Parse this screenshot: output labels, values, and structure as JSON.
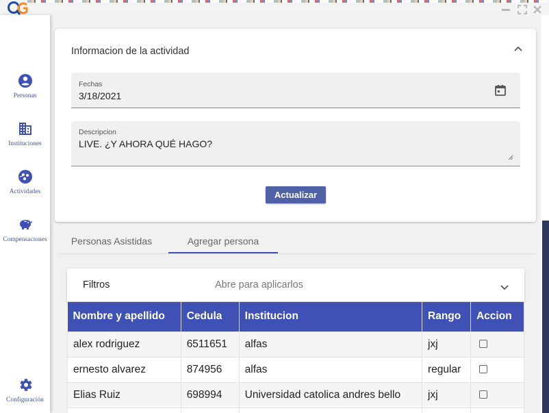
{
  "sidebar": {
    "items": [
      {
        "label": "Personas",
        "icon": "person-circle-icon"
      },
      {
        "label": "Instituciones",
        "icon": "building-icon"
      },
      {
        "label": "Actividades",
        "icon": "activities-icon"
      },
      {
        "label": "Compensaciones",
        "icon": "piggy-bank-icon"
      }
    ],
    "settings_label": "Configuración"
  },
  "card": {
    "title": "Informacion de la actividad",
    "date_label": "Fechas",
    "date_value": "3/18/2021",
    "description_label": "Descripcion",
    "description_value": "LIVE. ¿Y AHORA QUÉ HAGO?",
    "update_button": "Actualizar"
  },
  "tabs": [
    {
      "label": "Personas Asistidas",
      "active": false
    },
    {
      "label": "Agregar persona",
      "active": true
    }
  ],
  "filter": {
    "title": "Filtros",
    "hint": "Abre para aplicarlos"
  },
  "table": {
    "columns": [
      "Nombre y apellido",
      "Cedula",
      "Institucion",
      "Rango",
      "Accion"
    ],
    "rows": [
      {
        "name": "alex rodriguez",
        "cedula": "6511651",
        "institucion": "alfas",
        "rango": "jxj"
      },
      {
        "name": "ernesto alvarez",
        "cedula": "874956",
        "institucion": "alfas",
        "rango": "regular"
      },
      {
        "name": "Elias Ruiz",
        "cedula": "698994",
        "institucion": "Universidad catolica andres bello",
        "rango": "jxj"
      }
    ]
  },
  "colors": {
    "primary": "#3f51b5",
    "button": "#4f62a8",
    "logo_orange": "#f28c28",
    "logo_blue": "#1f4aa8"
  }
}
